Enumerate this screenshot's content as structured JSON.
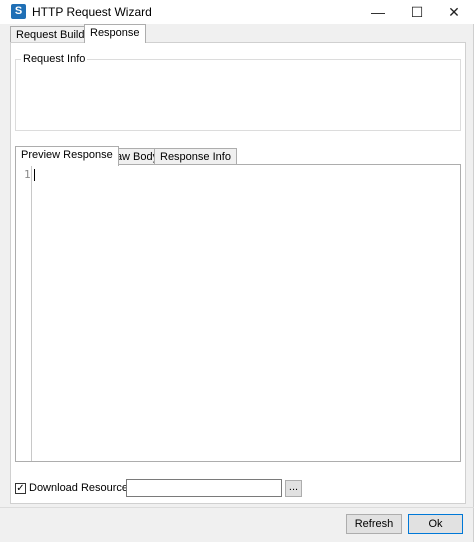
{
  "window": {
    "title": "HTTP Request Wizard",
    "app_icon_glyph": "S",
    "controls": {
      "minimize": "—",
      "maximize": "☐",
      "close": "✕"
    }
  },
  "tabs": [
    {
      "label": "Request Builder",
      "active": false
    },
    {
      "label": "Response",
      "active": true
    }
  ],
  "request_info": {
    "legend": "Request Info"
  },
  "inner_tabs": [
    {
      "label": "Preview Response",
      "active": true
    },
    {
      "label": "Raw Body",
      "active": false
    },
    {
      "label": "Response Info",
      "active": false
    }
  ],
  "editor": {
    "line_number": "1"
  },
  "download": {
    "checkbox_mark": "✓",
    "checked": true,
    "label": "Download Resource",
    "path_value": "",
    "browse_label": "..."
  },
  "buttons": {
    "refresh": "Refresh",
    "ok": "Ok"
  },
  "colors": {
    "app_icon": "#1f6fb5",
    "default_button_border": "#0078d7"
  }
}
